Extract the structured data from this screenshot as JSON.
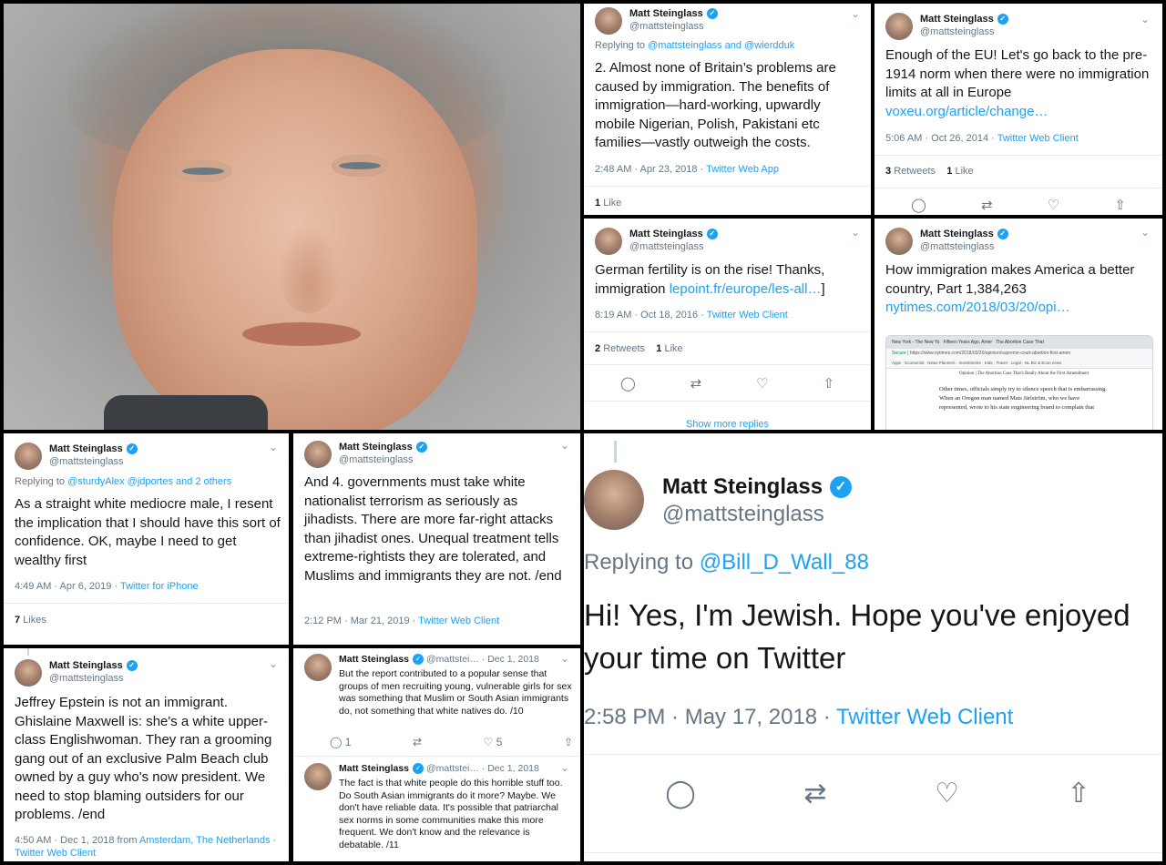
{
  "author": {
    "display_name": "Matt Steinglass",
    "handle": "@mattsteinglass"
  },
  "colors": {
    "link": "#1da1f2",
    "muted": "#657786",
    "text": "#14171a",
    "background": "#000000"
  },
  "icons": [
    "reply-icon",
    "retweet-icon",
    "like-icon",
    "share-icon",
    "chevron-down-icon",
    "verified-icon"
  ],
  "tweet_a": {
    "reply_prefix": "Replying to",
    "reply_to": "@mattsteinglass and @wierdduk",
    "text": "2. Almost none of Britain’s problems are caused by immigration. The benefits of immigration—hard-working, upwardly mobile Nigerian, Polish, Pakistani etc families—vastly outweigh the costs.",
    "meta_time": "2:48 AM · Apr 23, 2018 ·",
    "meta_client": "Twitter Web App",
    "likes_count": "1",
    "likes_label": "Like"
  },
  "tweet_b": {
    "text": "Enough of the EU! Let's go back to the pre-1914 norm when there were no immigration limits at all in Europe",
    "link": "voxeu.org/article/change…",
    "meta_time": "5:06 AM · Oct 26, 2014 ·",
    "meta_client": "Twitter Web Client",
    "retweets_count": "3",
    "retweets_label": "Retweets",
    "likes_count": "1",
    "likes_label": "Like"
  },
  "tweet_c": {
    "text": "German fertility is on the rise! Thanks, immigration",
    "link": "lepoint.fr/europe/les-all…",
    "link_suffix": "]",
    "meta_time": "8:19 AM · Oct 18, 2016 ·",
    "meta_client": "Twitter Web Client",
    "retweets_count": "2",
    "retweets_label": "Retweets",
    "likes_count": "1",
    "likes_label": "Like",
    "show_more": "Show more replies"
  },
  "tweet_d": {
    "text": "How immigration makes America a better country, Part 1,384,263",
    "link": "nytimes.com/2018/03/20/opi…",
    "preview": {
      "tab1": "New York - The New Yo",
      "tab2": "Fifteen Years Ago, Amer",
      "tab3": "The Abortion Case That",
      "secure": "Secure",
      "url": "https://www.nytimes.com/2018/03/20/opinion/supreme-court-abortion-first-amen",
      "bookmarks": "Apps · Economist · News Planners · Investments · Kids · Travel · Legal · NL Biz & Econ news",
      "section": "Opinion",
      "headline": "The Abortion Case That's Really About the First Amendment",
      "body1": "Other times, officials simply try to silence speech that is embarrassing.",
      "body2": "When an Oregon man named Mats Järlström, who we have",
      "body3": "represented, wrote to his state engineering board to complain that"
    }
  },
  "tweet_e": {
    "reply_prefix": "Replying to",
    "reply_to": "@sturdyAlex @jdportes and 2 others",
    "text": "As a straight white mediocre male, I resent the implication that I should have this sort of confidence. OK, maybe I need to get wealthy first",
    "meta_time": "4:49 AM · Apr 6, 2019 ·",
    "meta_client": "Twitter for iPhone",
    "likes_count": "7",
    "likes_label": "Likes"
  },
  "tweet_f": {
    "text": "And 4. governments must take white nationalist terrorism as seriously as jihadists. There are more far-right attacks than jihadist ones. Unequal treatment tells extreme-rightists they are tolerated, and Muslims and immigrants they are not. /end",
    "meta_time": "2:12 PM · Mar 21, 2019 ·",
    "meta_client": "Twitter Web Client"
  },
  "tweet_g": {
    "reply_prefix": "Replying to",
    "reply_to": "@Bill_D_Wall_88",
    "text": "Hi! Yes, I'm Jewish. Hope you've enjoyed your time on Twitter",
    "meta_time": "2:58 PM · May 17, 2018 ·",
    "meta_client": "Twitter Web Client"
  },
  "tweet_h": {
    "text": "Jeffrey Epstein is not an immigrant. Ghislaine Maxwell is: she's a white upper-class Englishwoman. They ran a grooming gang out of an exclusive Palm Beach club owned by a guy who's now president. We need to stop blaming outsiders for our problems. /end",
    "meta_time": "4:50 AM · Dec 1, 2018 from",
    "meta_place": "Amsterdam, The Netherlands",
    "meta_sep": "·",
    "meta_client": "Twitter Web Client"
  },
  "tweet_i": {
    "handle_short": "@mattstei…",
    "date": "· Dec 1, 2018",
    "text": "But the report contributed to a popular sense that groups of men recruiting young, vulnerable girls for sex was something that Muslim or South Asian immigrants do, not something that white natives do. /10",
    "replies": "1",
    "likes": "5"
  },
  "tweet_j": {
    "handle_short": "@mattstei…",
    "date": "· Dec 1, 2018",
    "text": "The fact is that white people do this horrible stuff too. Do South Asian immigrants do it more? Maybe. We don't have reliable data. It's possible that patriarchal sex norms in some communities make this more frequent. We don't know and the relevance is debatable. /11"
  }
}
